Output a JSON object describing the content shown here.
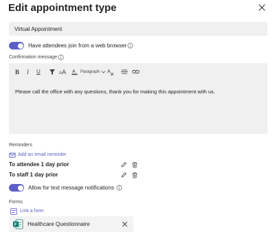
{
  "dialog": {
    "title": "Edit appointment type"
  },
  "appointment_name": {
    "value": "Virtual Appointment"
  },
  "web_join": {
    "label": "Have attendees join from a web browser",
    "enabled": true
  },
  "confirmation": {
    "label": "Confirmation message",
    "toolbar": {
      "paragraph_label": "Paragraph",
      "bold": "B",
      "italic": "I",
      "underline": "U"
    },
    "body": "Please call the office with any questions, thank you for making this appointment with us."
  },
  "reminders": {
    "label": "Reminders",
    "add_label": "Add an email reminder",
    "items": [
      {
        "text": "To attendee 1 day prior"
      },
      {
        "text": "To staff 1 day prior"
      }
    ]
  },
  "text_notifications": {
    "label": "Allow for text message notifications",
    "enabled": true
  },
  "forms": {
    "label": "Forms",
    "link_label": "Link a form",
    "attached": {
      "name": "Healthcare Questionnaire"
    }
  },
  "colors": {
    "accent": "#5b5fc7",
    "field_bg": "#f0f0f0",
    "text": "#242424",
    "forms_icon": "#077568"
  }
}
